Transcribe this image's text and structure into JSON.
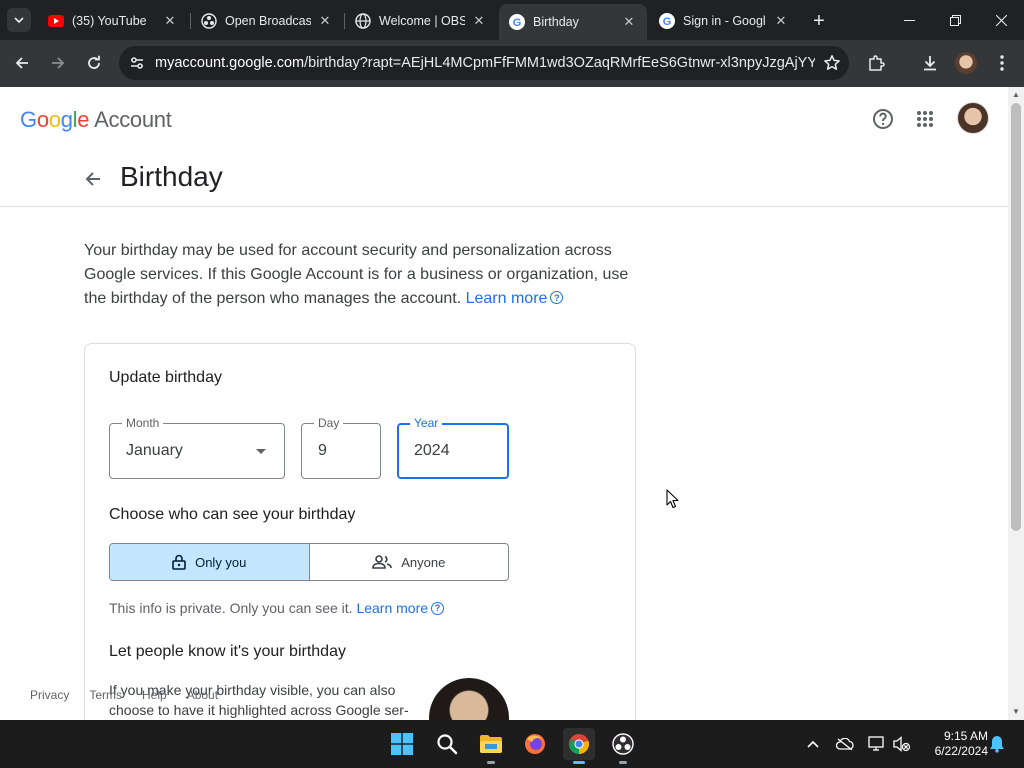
{
  "browser": {
    "tabs": [
      {
        "title": "(35) YouTube",
        "favicon": "youtube-icon",
        "active": false
      },
      {
        "title": "Open Broadcas",
        "favicon": "obs-icon",
        "active": false
      },
      {
        "title": "Welcome | OBS",
        "favicon": "globe-icon",
        "active": false
      },
      {
        "title": "Birthday",
        "favicon": "google-icon",
        "active": true
      },
      {
        "title": "Sign in - Googl",
        "favicon": "google-icon",
        "active": false
      }
    ],
    "url_host": "myaccount.google.com",
    "url_rest": "/birthday?rapt=AEjHL4MCpmFfFMM1wd3OZaqRMrfEeS6Gtnwr-xl3npyJzgAjYYp..."
  },
  "header": {
    "logo_google": "Google",
    "logo_account": "Account"
  },
  "page": {
    "title": "Birthday",
    "description": "Your birthday may be used for account security and personalization across Google services. If this Google Account is for a business or organization, use the birthday of the person who manages the account.",
    "learn_more": "Learn more"
  },
  "card": {
    "title": "Update birthday",
    "month_label": "Month",
    "month_value": "January",
    "day_label": "Day",
    "day_value": "9",
    "year_label": "Year",
    "year_value": "2024",
    "visibility_title": "Choose who can see your birthday",
    "option_only_you": "Only you",
    "option_anyone": "Anyone",
    "private_note": "This info is private. Only you can see it.",
    "learn_more": "Learn more",
    "let_people_title": "Let people know it's your birthday",
    "let_people_text": "If you make your birthday visible, you can also choose to have it highlighted across Google ser-"
  },
  "footer": {
    "links": [
      "Privacy",
      "Terms",
      "Help",
      "About"
    ]
  },
  "taskbar": {
    "time": "9:15 AM",
    "date": "6/22/2024"
  },
  "colors": {
    "accent": "#1a73e8",
    "selected_option_bg": "#c2e7ff"
  }
}
